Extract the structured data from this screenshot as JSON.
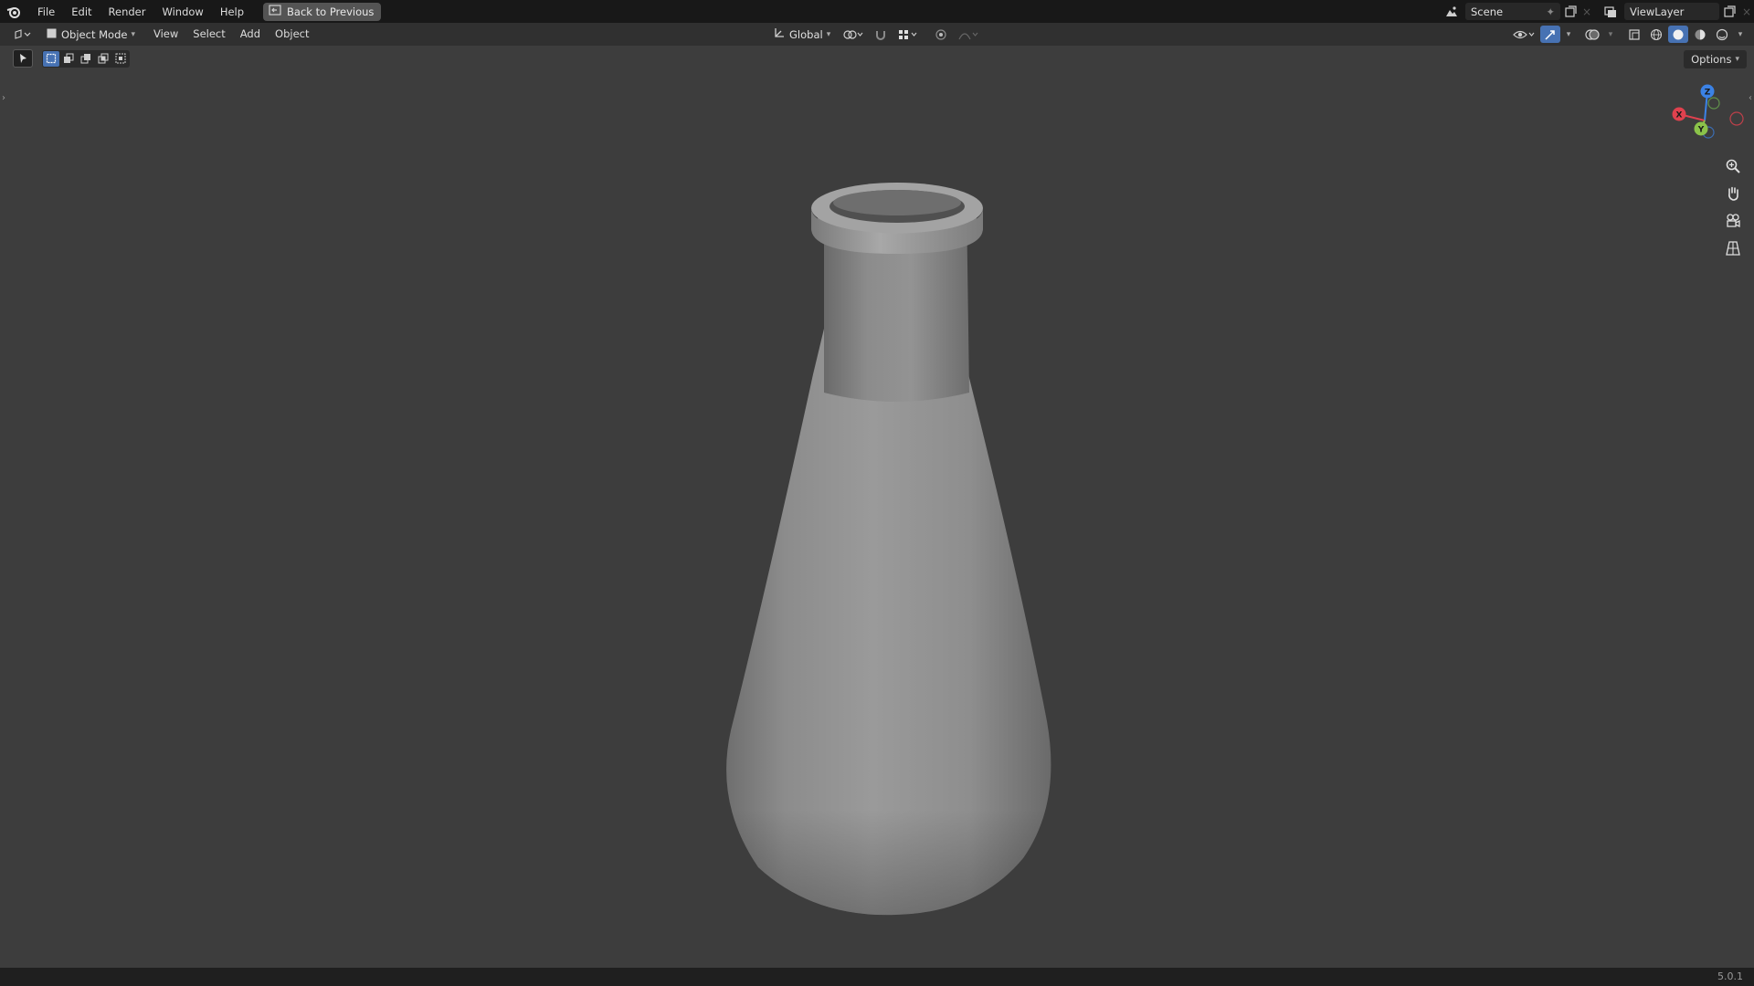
{
  "topbar": {
    "menus": [
      "File",
      "Edit",
      "Render",
      "Window",
      "Help"
    ],
    "back_label": "Back to Previous",
    "scene_name": "Scene",
    "view_layer_name": "ViewLayer"
  },
  "header": {
    "mode_label": "Object Mode",
    "menus": [
      "View",
      "Select",
      "Add",
      "Object"
    ],
    "transform_orientation": "Global"
  },
  "viewport": {
    "options_label": "Options",
    "gizmo": {
      "x_label": "X",
      "y_label": "Y",
      "z_label": "Z"
    },
    "object_name": "flask"
  },
  "status": {
    "version": "5.0.1"
  },
  "colors": {
    "accent": "#4772b3",
    "axis_x": "#e0414e",
    "axis_y": "#8bc34a",
    "axis_z": "#3b82e6",
    "viewport_bg": "#3d3d3d"
  }
}
